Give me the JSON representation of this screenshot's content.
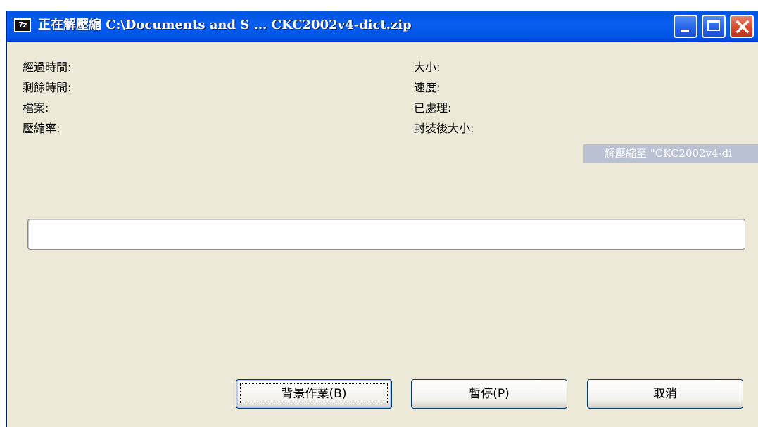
{
  "window": {
    "title": "正在解壓縮 C:\\Documents and S ... CKC2002v4-dict.zip",
    "app_icon_text": "7z"
  },
  "stats": {
    "elapsed_label": "經過時間:",
    "remaining_label": "剩餘時間:",
    "files_label": "檔案:",
    "ratio_label": "壓縮率:",
    "size_label": "大小:",
    "speed_label": "速度:",
    "processed_label": "已處理:",
    "packed_size_label": "封裝後大小:"
  },
  "destination_text": "解壓縮至 \"CKC2002v4-di",
  "progress": {
    "value": 0
  },
  "buttons": {
    "background": "背景作業(B)",
    "pause": "暫停(P)",
    "cancel": "取消"
  },
  "colors": {
    "titlebar": "#0054e3",
    "window_bg": "#ece9d8",
    "close_button": "#d4452c"
  }
}
